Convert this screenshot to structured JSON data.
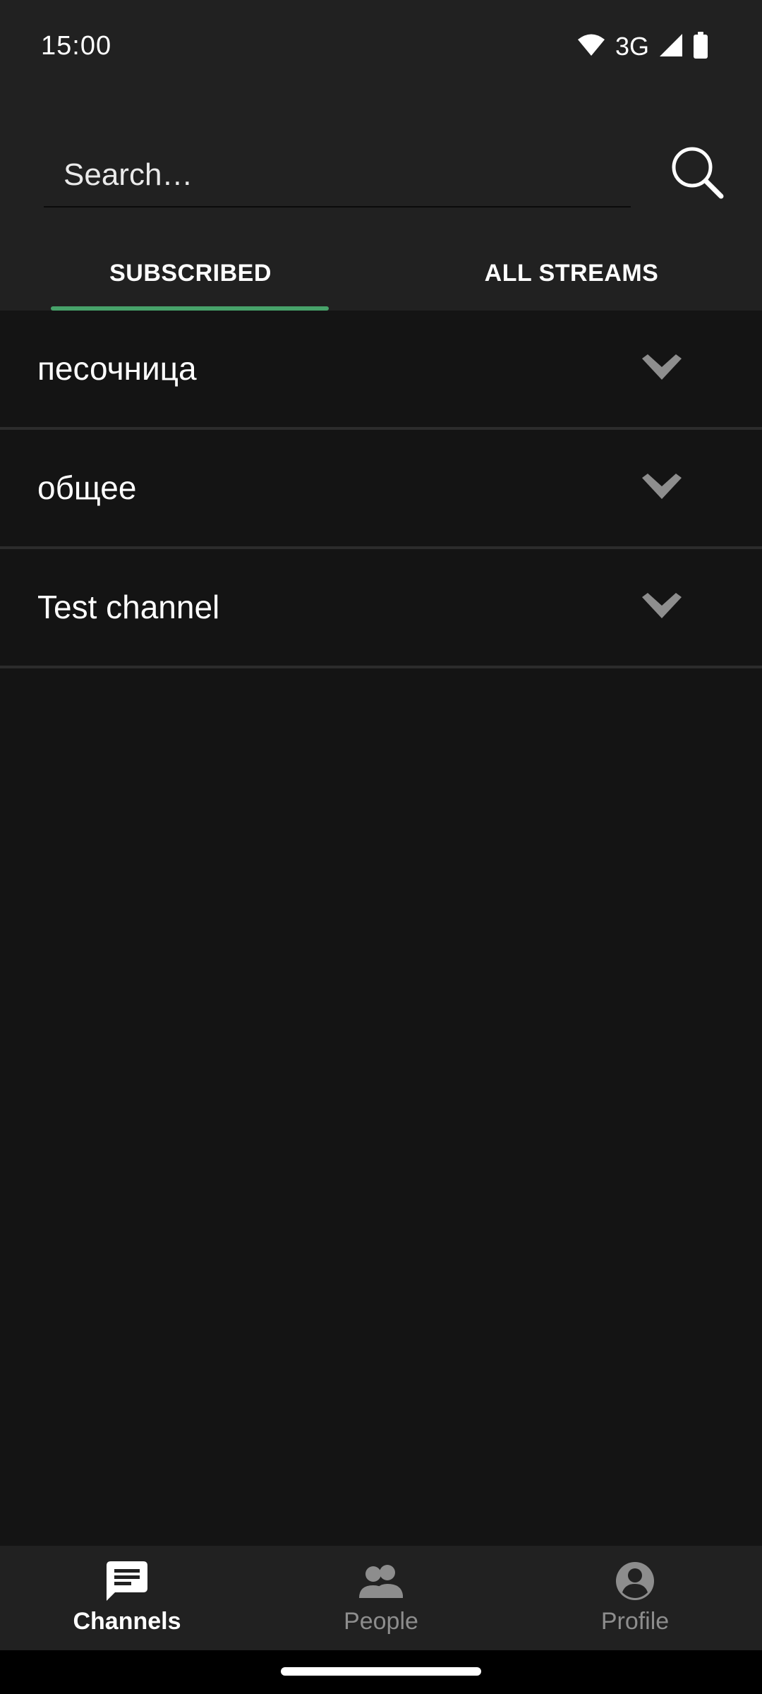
{
  "status_bar": {
    "time": "15:00",
    "network": "3G",
    "icons": [
      "wifi-icon",
      "signal-icon",
      "battery-icon"
    ]
  },
  "search": {
    "placeholder": "Search…",
    "value": "",
    "icon": "search-icon"
  },
  "tabs": [
    {
      "label": "SUBSCRIBED",
      "selected": true
    },
    {
      "label": "ALL STREAMS",
      "selected": false
    }
  ],
  "streams": [
    {
      "name": "песочница",
      "icon": "chevron-down-icon"
    },
    {
      "name": "общее",
      "icon": "chevron-down-icon"
    },
    {
      "name": "Test channel",
      "icon": "chevron-down-icon"
    }
  ],
  "bottom_nav": [
    {
      "label": "Channels",
      "icon": "chat-icon",
      "active": true
    },
    {
      "label": "People",
      "icon": "people-icon",
      "active": false
    },
    {
      "label": "Profile",
      "icon": "profile-icon",
      "active": false
    }
  ],
  "colors": {
    "background": "#141414",
    "surface": "#212121",
    "accent": "#47a36a",
    "divider": "#2c2c2c",
    "inactive": "#8d8d8d"
  }
}
